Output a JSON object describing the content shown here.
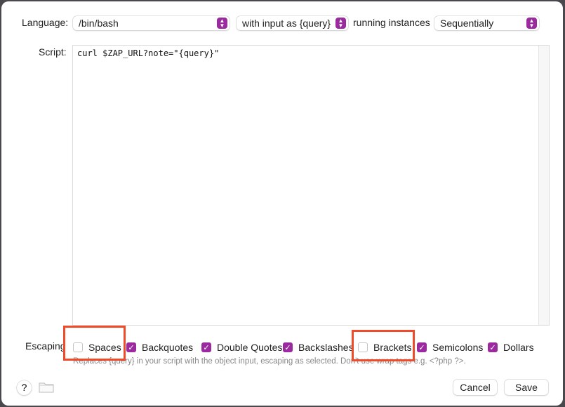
{
  "language": {
    "label": "Language:",
    "value": "/bin/bash"
  },
  "input_mode": {
    "value": "with input as {query}"
  },
  "running": {
    "label": "running instances",
    "value": "Sequentially"
  },
  "script": {
    "label": "Script:",
    "value": "curl $ZAP_URL?note=\"{query}\""
  },
  "escaping": {
    "label": "Escaping",
    "options": [
      {
        "label": "Spaces",
        "checked": false
      },
      {
        "label": "Backquotes",
        "checked": true
      },
      {
        "label": "Double Quotes",
        "checked": true
      },
      {
        "label": "Backslashes",
        "checked": true
      },
      {
        "label": "Brackets",
        "checked": false
      },
      {
        "label": "Semicolons",
        "checked": true
      },
      {
        "label": "Dollars",
        "checked": true
      }
    ],
    "help": "Replaces {query} in your script with the object input, escaping as selected. Don't use wrap tags e.g. <?php ?>."
  },
  "footer": {
    "help_label": "?",
    "cancel_label": "Cancel",
    "save_label": "Save"
  },
  "colors": {
    "accent": "#9b2a9f",
    "highlight": "#f04a2a"
  }
}
